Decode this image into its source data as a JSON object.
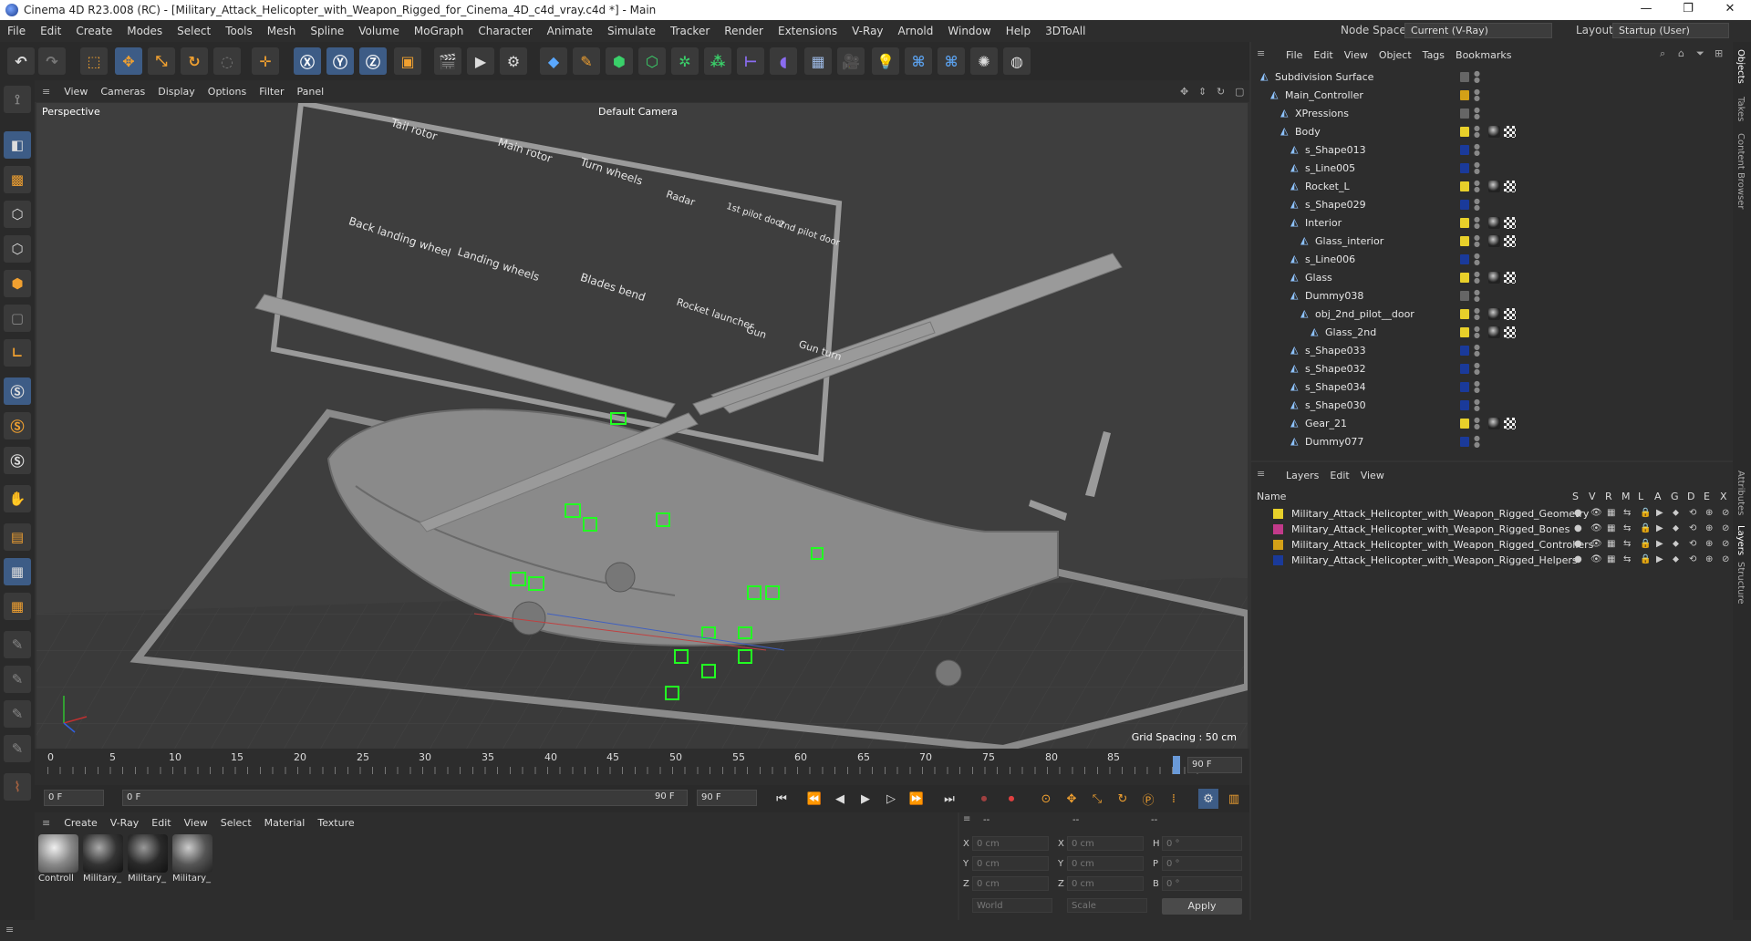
{
  "window": {
    "title": "Cinema 4D R23.008 (RC) - [Military_Attack_Helicopter_with_Weapon_Rigged_for_Cinema_4D_c4d_vray.c4d *] - Main",
    "minimize": "—",
    "maximize": "❐",
    "close": "✕"
  },
  "menubar": {
    "items": [
      "File",
      "Edit",
      "Create",
      "Modes",
      "Select",
      "Tools",
      "Mesh",
      "Spline",
      "Volume",
      "MoGraph",
      "Character",
      "Animate",
      "Simulate",
      "Tracker",
      "Render",
      "Extensions",
      "V-Ray",
      "Arnold",
      "Window",
      "Help",
      "3DToAll"
    ],
    "node_space_label": "Node Space:",
    "node_space_value": "Current (V-Ray)",
    "layout_label": "Layout:",
    "layout_value": "Startup (User)"
  },
  "viewport": {
    "menu": [
      "View",
      "Cameras",
      "Display",
      "Options",
      "Filter",
      "Panel"
    ],
    "view_name": "Perspective",
    "camera": "Default Camera",
    "grid_spacing": "Grid Spacing : 50 cm",
    "board_labels": [
      "Tail rotor",
      "Main rotor",
      "Turn wheels",
      "Radar",
      "1st pilot door",
      "2nd pilot door",
      "Back landing wheel",
      "Landing wheels",
      "Blades bend",
      "Rocket launcher",
      "Gun",
      "Gun turn"
    ]
  },
  "timeline": {
    "ticks": [
      "0",
      "5",
      "10",
      "15",
      "20",
      "25",
      "30",
      "35",
      "40",
      "45",
      "50",
      "55",
      "60",
      "65",
      "70",
      "75",
      "80",
      "85"
    ],
    "current": "90 F",
    "start_field": "0 F",
    "range_start": "0 F",
    "range_end": "90 F",
    "end_field": "90 F"
  },
  "material_manager": {
    "menu": [
      "Create",
      "V-Ray",
      "Edit",
      "View",
      "Select",
      "Material",
      "Texture"
    ],
    "materials": [
      "Controll",
      "Military_",
      "Military_",
      "Military_"
    ]
  },
  "coordinates": {
    "header": [
      "--",
      "--",
      "--"
    ],
    "rows": [
      {
        "axis": "X",
        "pos": "0 cm",
        "axis2": "X",
        "size": "0 cm",
        "axis3": "H",
        "rot": "0 °"
      },
      {
        "axis": "Y",
        "pos": "0 cm",
        "axis2": "Y",
        "size": "0 cm",
        "axis3": "P",
        "rot": "0 °"
      },
      {
        "axis": "Z",
        "pos": "0 cm",
        "axis2": "Z",
        "size": "0 cm",
        "axis3": "B",
        "rot": "0 °"
      }
    ],
    "mode": "World",
    "scale": "Scale",
    "apply": "Apply"
  },
  "objects_panel": {
    "menu": [
      "File",
      "Edit",
      "View",
      "Object",
      "Tags",
      "Bookmarks"
    ],
    "rows": [
      {
        "name": "Subdivision Surface",
        "indent": 0,
        "color": "",
        "check": true
      },
      {
        "name": "Main_Controller",
        "indent": 1,
        "color": "#d4a017"
      },
      {
        "name": "XPressions",
        "indent": 2,
        "color": "",
        "check": true
      },
      {
        "name": "Body",
        "indent": 2,
        "color": "#e8d02a"
      },
      {
        "name": "s_Shape013",
        "indent": 3,
        "color": "#1a3a9a"
      },
      {
        "name": "s_Line005",
        "indent": 3,
        "color": "#1a3a9a"
      },
      {
        "name": "Rocket_L",
        "indent": 3,
        "color": "#e8d02a"
      },
      {
        "name": "s_Shape029",
        "indent": 3,
        "color": "#1a3a9a"
      },
      {
        "name": "Interior",
        "indent": 3,
        "color": "#e8d02a"
      },
      {
        "name": "Glass_interior",
        "indent": 4,
        "color": "#e8d02a"
      },
      {
        "name": "s_Line006",
        "indent": 3,
        "color": "#1a3a9a"
      },
      {
        "name": "Glass",
        "indent": 3,
        "color": "#e8d02a"
      },
      {
        "name": "Dummy038",
        "indent": 3,
        "color": "",
        "check": true
      },
      {
        "name": "obj_2nd_pilot__door",
        "indent": 4,
        "color": "#e8d02a"
      },
      {
        "name": "Glass_2nd",
        "indent": 5,
        "color": "#e8d02a"
      },
      {
        "name": "s_Shape033",
        "indent": 3,
        "color": "#1a3a9a"
      },
      {
        "name": "s_Shape032",
        "indent": 3,
        "color": "#1a3a9a"
      },
      {
        "name": "s_Shape034",
        "indent": 3,
        "color": "#1a3a9a"
      },
      {
        "name": "s_Shape030",
        "indent": 3,
        "color": "#1a3a9a"
      },
      {
        "name": "Gear_21",
        "indent": 3,
        "color": "#e8d02a"
      },
      {
        "name": "Dummy077",
        "indent": 3,
        "color": "#1a3a9a"
      }
    ]
  },
  "layers_panel": {
    "menu": [
      "Layers",
      "Edit",
      "View"
    ],
    "col_name": "Name",
    "cols": [
      "S",
      "V",
      "R",
      "M",
      "L",
      "A",
      "G",
      "D",
      "E",
      "X"
    ],
    "rows": [
      {
        "name": "Military_Attack_Helicopter_with_Weapon_Rigged_Geometry",
        "color": "#e8d02a"
      },
      {
        "name": "Military_Attack_Helicopter_with_Weapon_Rigged_Bones",
        "color": "#c23a8a"
      },
      {
        "name": "Military_Attack_Helicopter_with_Weapon_Rigged_Controllers",
        "color": "#d4a017"
      },
      {
        "name": "Military_Attack_Helicopter_with_Weapon_Rigged_Helpers",
        "color": "#1a3a9a"
      }
    ]
  },
  "side_tabs": [
    "Objects",
    "Takes",
    "Content Browser",
    "Attributes",
    "Layers",
    "Structure"
  ]
}
